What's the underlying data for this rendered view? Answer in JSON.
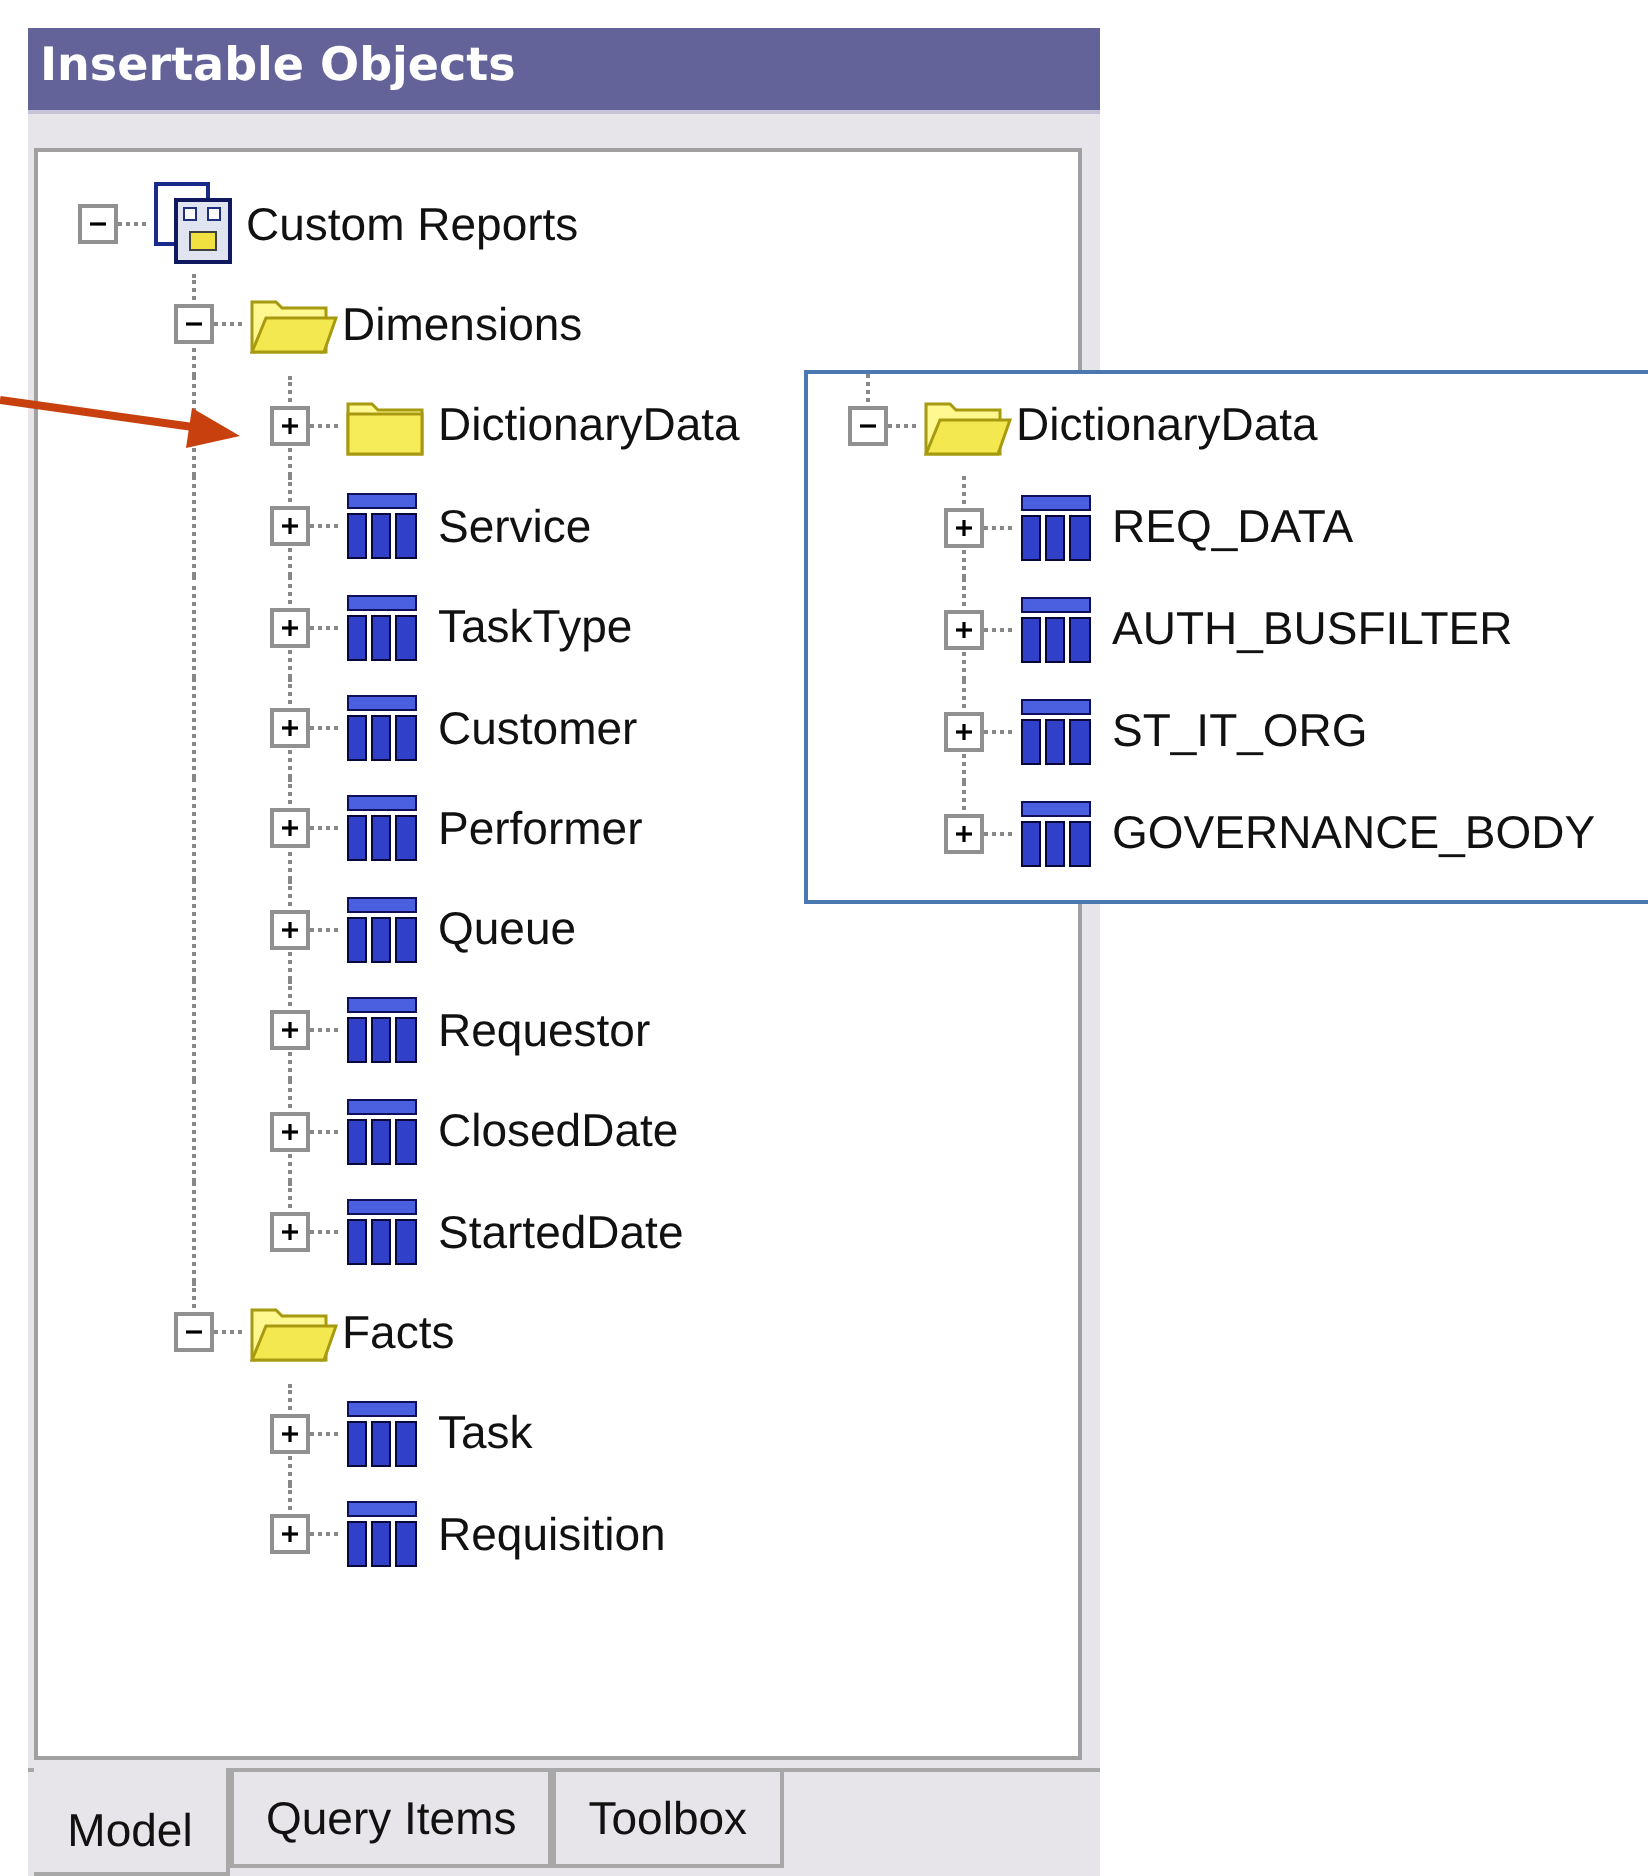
{
  "panel": {
    "title": "Insertable Objects",
    "tree": [
      {
        "label": "Custom Reports",
        "kind": "model",
        "expanded": true,
        "children": [
          {
            "label": "Dimensions",
            "kind": "folder",
            "expanded": true,
            "children": [
              {
                "label": "DictionaryData",
                "kind": "folder",
                "expanded": false
              },
              {
                "label": "Service",
                "kind": "table",
                "expanded": false
              },
              {
                "label": "TaskType",
                "kind": "table",
                "expanded": false
              },
              {
                "label": "Customer",
                "kind": "table",
                "expanded": false
              },
              {
                "label": "Performer",
                "kind": "table",
                "expanded": false
              },
              {
                "label": "Queue",
                "kind": "table",
                "expanded": false
              },
              {
                "label": "Requestor",
                "kind": "table",
                "expanded": false
              },
              {
                "label": "ClosedDate",
                "kind": "table",
                "expanded": false
              },
              {
                "label": "StartedDate",
                "kind": "table",
                "expanded": false
              }
            ]
          },
          {
            "label": "Facts",
            "kind": "folder",
            "expanded": true,
            "children": [
              {
                "label": "Task",
                "kind": "table",
                "expanded": false
              },
              {
                "label": "Requisition",
                "kind": "table",
                "expanded": false
              }
            ]
          }
        ]
      }
    ]
  },
  "tabs": [
    {
      "label": "Model",
      "selected": true
    },
    {
      "label": "Query Items",
      "selected": false
    },
    {
      "label": "Toolbox",
      "selected": false
    }
  ],
  "callout": {
    "tree": [
      {
        "label": "DictionaryData",
        "kind": "folder",
        "expanded": true,
        "children": [
          {
            "label": "REQ_DATA",
            "kind": "table",
            "expanded": false
          },
          {
            "label": "AUTH_BUSFILTER",
            "kind": "table",
            "expanded": false
          },
          {
            "label": "ST_IT_ORG",
            "kind": "table",
            "expanded": false
          },
          {
            "label": "GOVERNANCE_BODY",
            "kind": "table",
            "expanded": false
          }
        ]
      }
    ]
  }
}
